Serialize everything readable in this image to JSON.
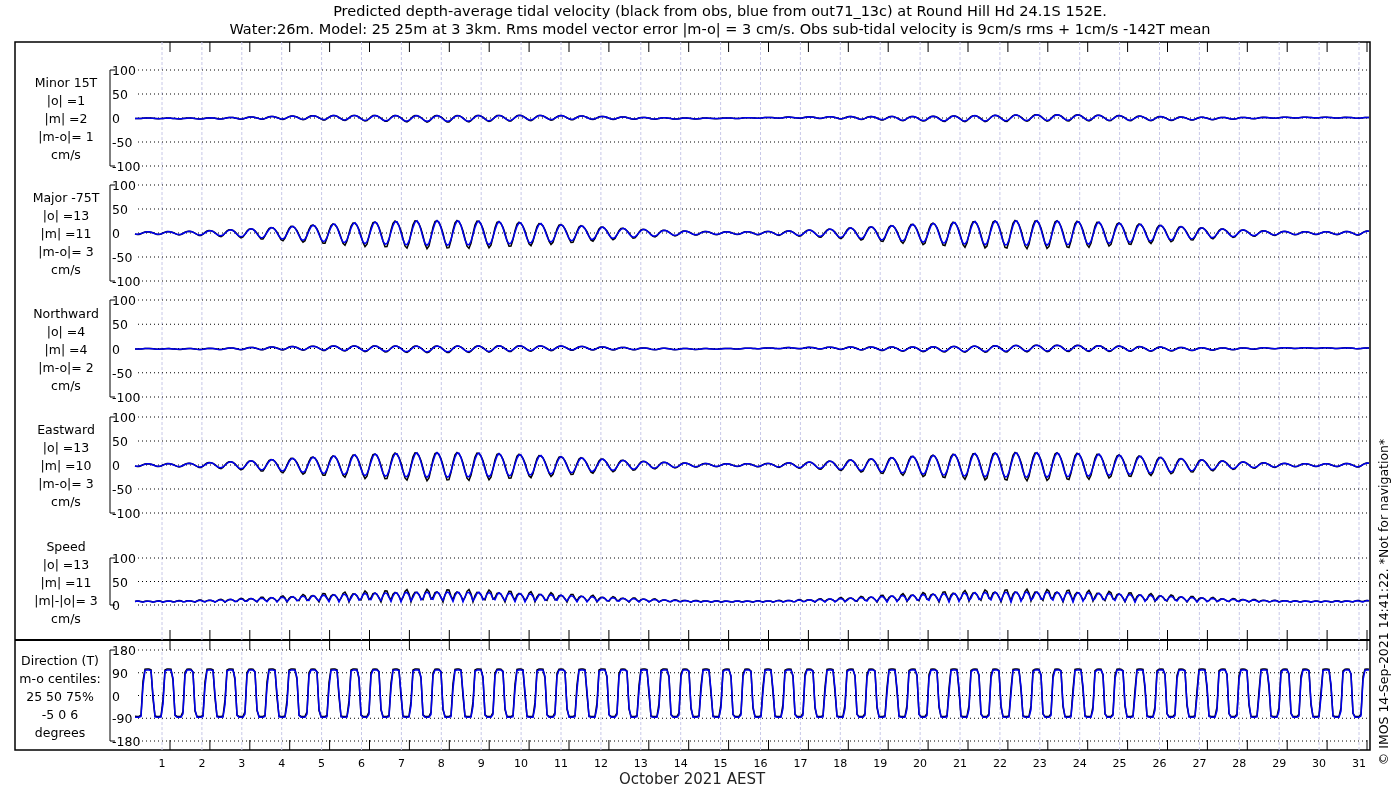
{
  "title": [
    "Predicted depth-average tidal velocity (black from obs, blue from out71_13c) at Round Hill Hd 24.1S 152E.",
    "Water:26m. Model: 25 25m at 3 3km. Rms model vector error |m-o| = 3 cm/s. Obs sub-tidal velocity is 9cm/s rms + 1cm/s -142T mean"
  ],
  "panels": [
    {
      "kind": "weak",
      "label": [
        "Minor 15T",
        "|o| =1",
        "|m| =2",
        "|m-o|= 1",
        "cm/s"
      ],
      "yticks": [
        "100",
        "50",
        "0",
        "-50",
        "-100"
      ]
    },
    {
      "kind": "strong",
      "label": [
        "Major -75T",
        "|o| =13",
        "|m| =11",
        "|m-o|= 3",
        "cm/s"
      ],
      "yticks": [
        "100",
        "50",
        "0",
        "-50",
        "-100"
      ]
    },
    {
      "kind": "weak",
      "label": [
        "Northward",
        "|o| =4",
        "|m| =4",
        "|m-o|= 2",
        "cm/s"
      ],
      "yticks": [
        "100",
        "50",
        "0",
        "-50",
        "-100"
      ]
    },
    {
      "kind": "strong",
      "label": [
        "Eastward",
        "|o| =13",
        "|m| =10",
        "|m-o|= 3",
        "cm/s"
      ],
      "yticks": [
        "100",
        "50",
        "0",
        "-50",
        "-100"
      ]
    },
    {
      "kind": "speed",
      "label": [
        "Speed",
        "|o| =13",
        "|m| =11",
        "|m|-|o|= 3",
        "cm/s"
      ],
      "yticks": [
        "100",
        "50",
        "0"
      ]
    },
    {
      "kind": "direction",
      "label": [
        "Direction (T)",
        "m-o centiles:",
        "25  50  75%",
        "-5  0  6",
        "degrees"
      ],
      "yticks": [
        "180",
        "90",
        "0",
        "-90",
        "-180"
      ]
    }
  ],
  "days": [
    "1",
    "2",
    "3",
    "4",
    "5",
    "6",
    "7",
    "8",
    "9",
    "10",
    "11",
    "12",
    "13",
    "14",
    "15",
    "16",
    "17",
    "18",
    "19",
    "20",
    "21",
    "22",
    "23",
    "24",
    "25",
    "26",
    "27",
    "28",
    "29",
    "30",
    "31"
  ],
  "xlabel": "October 2021 AEST",
  "footer": "© IMOS 14-Sep-2021 14:41:22. *Not for navigation*"
}
